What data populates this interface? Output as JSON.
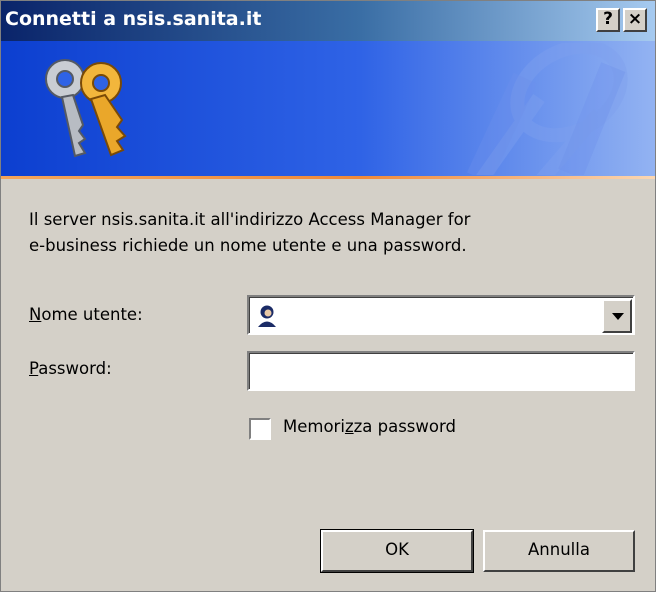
{
  "window": {
    "title": "Connetti a nsis.sanita.it",
    "help_button": "?",
    "close_button": "×"
  },
  "banner": {
    "icon": "keys-icon",
    "watermark": "keys-watermark",
    "colors": {
      "start": "#0c3fd0",
      "end": "#93b3f2",
      "edge": "#ef8a3a"
    }
  },
  "message": {
    "line1": "Il server nsis.sanita.it all'indirizzo Access Manager for",
    "line2": "e-business richiede un nome utente e una password."
  },
  "form": {
    "username": {
      "label_accel": "N",
      "label_rest": "ome utente:",
      "value": "",
      "icon": "user-icon"
    },
    "password": {
      "label_accel": "P",
      "label_rest": "assword:",
      "value": ""
    },
    "remember": {
      "label_pre": "Memori",
      "label_accel": "z",
      "label_post": "za password",
      "checked": false
    }
  },
  "buttons": {
    "ok": "OK",
    "cancel": "Annulla"
  }
}
